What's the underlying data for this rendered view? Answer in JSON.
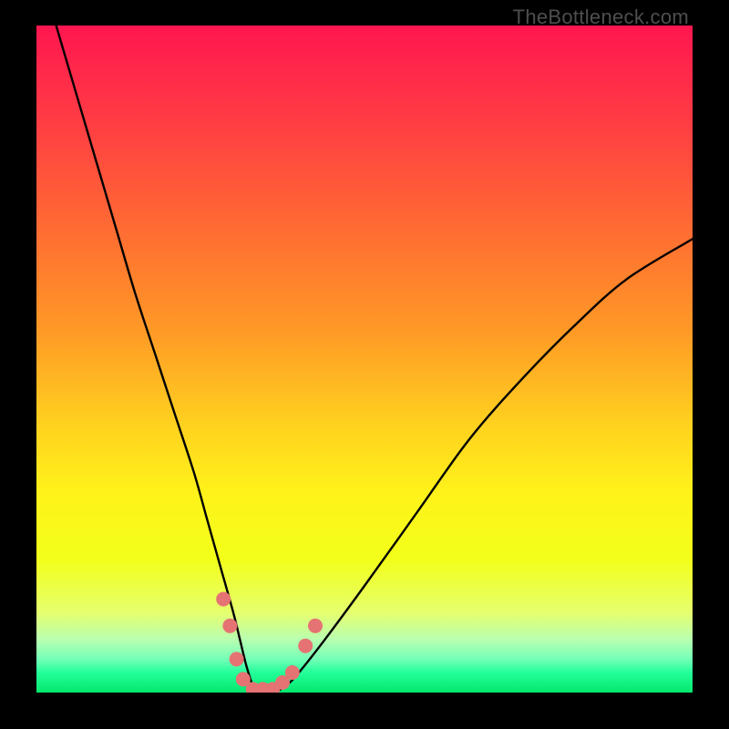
{
  "watermark": "TheBottleneck.com",
  "chart_data": {
    "type": "line",
    "title": "",
    "xlabel": "",
    "ylabel": "",
    "xlim": [
      0,
      100
    ],
    "ylim": [
      0,
      100
    ],
    "grid": false,
    "legend": false,
    "background_gradient": {
      "stops": [
        {
          "t": 0.0,
          "color": "#ff1650"
        },
        {
          "t": 0.14,
          "color": "#ff3b44"
        },
        {
          "t": 0.3,
          "color": "#ff6a33"
        },
        {
          "t": 0.46,
          "color": "#ff9a26"
        },
        {
          "t": 0.6,
          "color": "#ffd21f"
        },
        {
          "t": 0.7,
          "color": "#fff21a"
        },
        {
          "t": 0.8,
          "color": "#f2ff1a"
        },
        {
          "t": 0.88,
          "color": "#e6ff6e"
        },
        {
          "t": 0.92,
          "color": "#b9ffb0"
        },
        {
          "t": 0.95,
          "color": "#74ffb7"
        },
        {
          "t": 0.97,
          "color": "#24ff9a"
        },
        {
          "t": 1.0,
          "color": "#03e76d"
        }
      ]
    },
    "series": [
      {
        "name": "bottleneck-curve",
        "color": "#000000",
        "x": [
          3,
          6,
          9,
          12,
          15,
          18,
          21,
          24,
          26,
          28,
          30,
          31,
          32,
          33,
          34,
          36,
          38,
          40,
          44,
          50,
          58,
          66,
          74,
          82,
          90,
          100
        ],
        "y": [
          100,
          90,
          80,
          70,
          60,
          51,
          42,
          33,
          26,
          19,
          12,
          8,
          4,
          1,
          0,
          0,
          1,
          3,
          8,
          16,
          27,
          38,
          47,
          55,
          62,
          68
        ]
      }
    ],
    "markers": {
      "name": "highlight-points",
      "color": "#e57373",
      "radius_px": 8,
      "points": [
        {
          "x": 28.5,
          "y": 14
        },
        {
          "x": 29.5,
          "y": 10
        },
        {
          "x": 30.5,
          "y": 5
        },
        {
          "x": 31.5,
          "y": 2
        },
        {
          "x": 33.0,
          "y": 0.5
        },
        {
          "x": 34.5,
          "y": 0.5
        },
        {
          "x": 36.0,
          "y": 0.5
        },
        {
          "x": 37.5,
          "y": 1.5
        },
        {
          "x": 39.0,
          "y": 3
        },
        {
          "x": 41.0,
          "y": 7
        },
        {
          "x": 42.5,
          "y": 10
        }
      ]
    }
  }
}
